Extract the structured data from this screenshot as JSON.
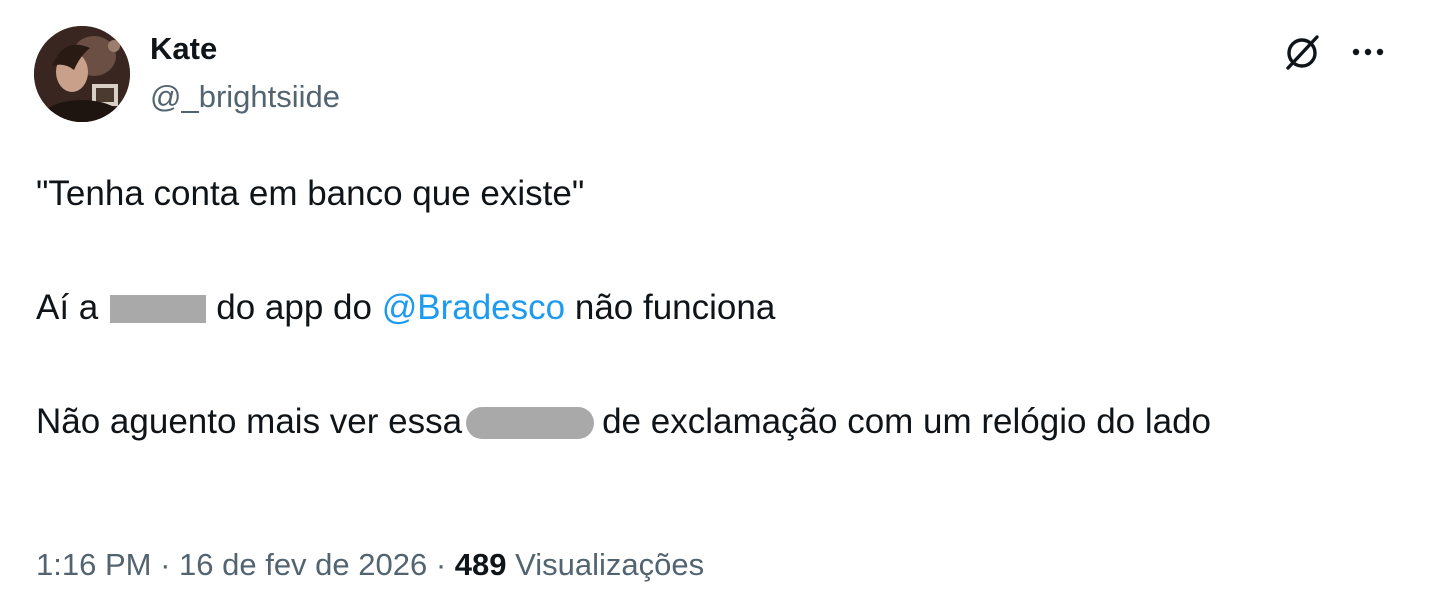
{
  "author": {
    "name": "Kate",
    "handle": "@_brightsiide",
    "avatar_icon": "user-avatar-photo"
  },
  "actions": {
    "grok_icon": "grok-icon",
    "more_icon": "more-options-icon"
  },
  "tweet": {
    "line1": "\"Tenha conta em banco que existe\"",
    "line2_before": "Aí a",
    "line2_middle": "do app do",
    "line2_mention": "@Bradesco",
    "line2_after": "não funciona",
    "line3_before": "Não aguento mais ver essa",
    "line3_after": "de exclamação com um relógio do lado"
  },
  "meta": {
    "time": "1:16 PM",
    "separator1": " · ",
    "date": "16 de fev de 2026",
    "separator2": " · ",
    "views_count": "489",
    "views_label": "Visualizações"
  },
  "colors": {
    "text": "#0f1419",
    "secondary": "#536471",
    "link": "#1d9bf0",
    "redaction": "#a9a9a9"
  }
}
